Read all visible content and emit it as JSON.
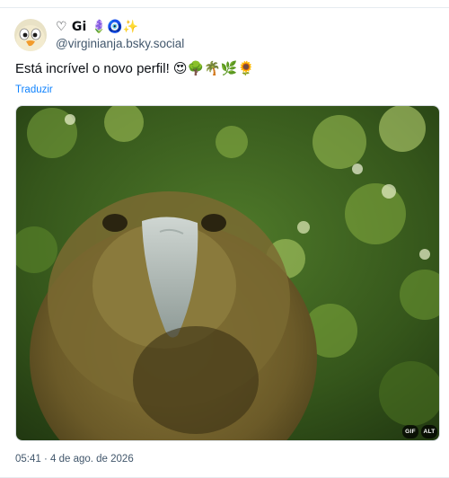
{
  "post": {
    "author": {
      "display_name": "♡ Gi 🪻🧿✨",
      "handle": "@virginianja.bsky.social",
      "avatar_icon": "cartoon-bird-avatar"
    },
    "text": "Está incrível o novo perfil! 😍🌳🌴🌿🌻",
    "translate_label": "Traduzir",
    "media": {
      "type": "gif",
      "description_icon": "kakapo-parrot-gif",
      "gif_badge": "GIF",
      "alt_badge": "ALT"
    },
    "timestamp": "05:41 · 4 de ago. de 2026"
  },
  "colors": {
    "link": "#1083fe",
    "muted": "#42576c",
    "divider": "#e6ebf0"
  }
}
